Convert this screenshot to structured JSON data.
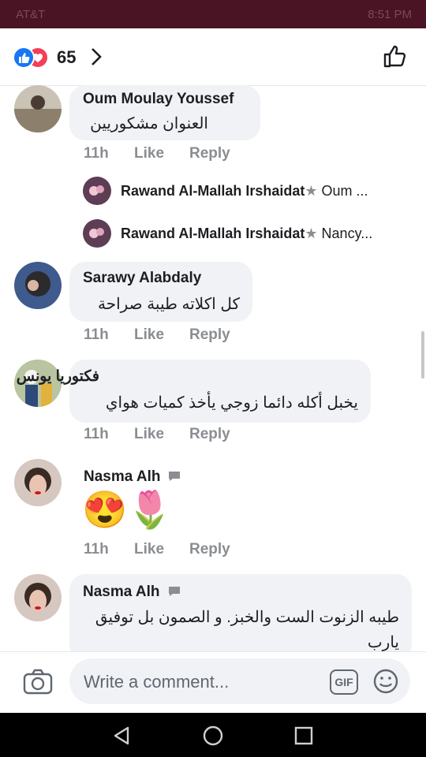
{
  "status_bar": {
    "carrier": "AT&T",
    "time": "8:51 PM"
  },
  "header": {
    "reaction_count": "65",
    "reaction_icons": [
      "like-icon",
      "love-icon"
    ]
  },
  "comments": [
    {
      "author": "Oum Moulay Youssef",
      "text": "العنوان مشكوريين",
      "time": "11h",
      "like": "Like",
      "reply": "Reply"
    },
    {
      "author": "Sarawy Alabdaly",
      "text": "كل اكلاته طيبة صراحة",
      "time": "11h",
      "like": "Like",
      "reply": "Reply"
    },
    {
      "author": "فكتوريا يونس",
      "text": "يخبل أكله دائما زوجي يأخذ كميات هواي",
      "time": "11h",
      "like": "Like",
      "reply": "Reply"
    },
    {
      "author": "Nasma Alh",
      "text": "😍🌷",
      "time": "11h",
      "like": "Like",
      "reply": "Reply"
    },
    {
      "author": "Nasma Alh",
      "text_line1": "طيبه الزنوت الست والخبز. و الصمون بل توفيق",
      "text_line2": "يارب"
    }
  ],
  "replies": [
    {
      "author": "Rawand Al-Mallah Irshaidat",
      "preview": "Oum ..."
    },
    {
      "author": "Rawand Al-Mallah Irshaidat",
      "preview": "Nancy..."
    }
  ],
  "composer": {
    "placeholder": "Write a comment...",
    "gif_label": "GIF"
  },
  "colors": {
    "status_bar": "#4a1424",
    "bubble": "#f0f2f5",
    "like_blue": "#1877f2",
    "love_red": "#f33e58",
    "meta_gray": "#8a8d91"
  }
}
